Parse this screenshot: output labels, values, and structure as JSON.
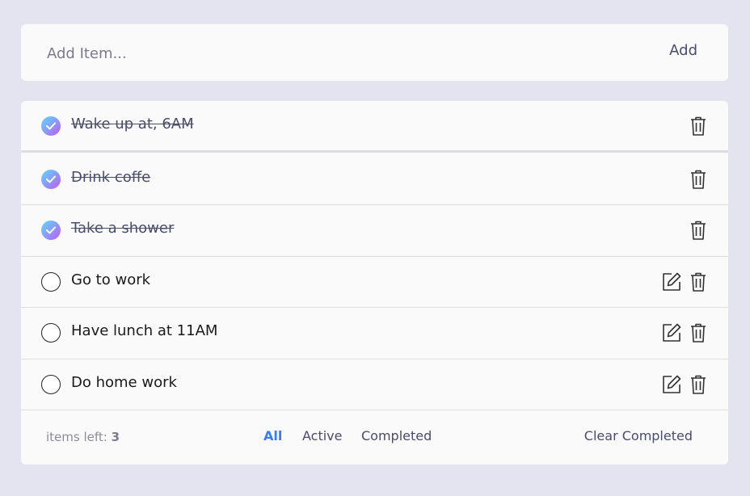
{
  "add_bar": {
    "placeholder": "Add Item...",
    "add_label": "Add"
  },
  "todos": [
    {
      "label": "Wake up at, 6AM",
      "completed": true
    },
    {
      "label": "Drink coffe",
      "completed": true
    },
    {
      "label": "Take a shower",
      "completed": true
    },
    {
      "label": "Go to work",
      "completed": false
    },
    {
      "label": "Have lunch at 11AM",
      "completed": false
    },
    {
      "label": "Do home work",
      "completed": false
    }
  ],
  "footer": {
    "items_left_label": "items left:",
    "items_left_count": "3",
    "filters": [
      {
        "label": "All",
        "active": true
      },
      {
        "label": "Active",
        "active": false
      },
      {
        "label": "Completed",
        "active": false
      }
    ],
    "clear_label": "Clear Completed"
  },
  "colors": {
    "background": "#e4e4f0",
    "card": "#fafafa",
    "accent": "#3a7bfd",
    "check_gradient_start": "#57ddff",
    "check_gradient_end": "#c058f3"
  },
  "icons": {
    "complete": "check-icon",
    "edit": "edit-icon",
    "delete": "trash-icon"
  }
}
